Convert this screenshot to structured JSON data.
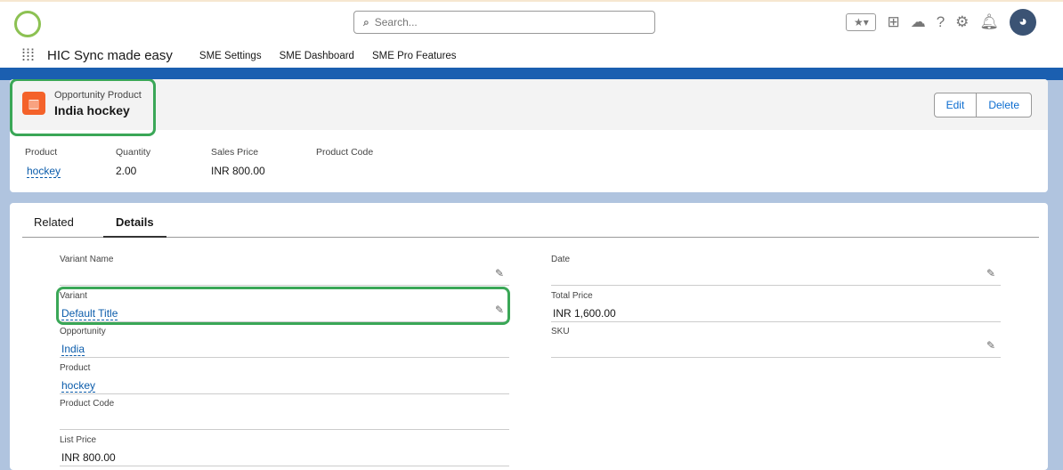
{
  "header": {
    "search_placeholder": "Search...",
    "app_name": "HIC Sync made easy",
    "nav": [
      "SME Settings",
      "SME Dashboard",
      "SME Pro Features"
    ]
  },
  "record": {
    "object": "Opportunity Product",
    "title": "India hockey",
    "edit": "Edit",
    "delete": "Delete",
    "highlights": [
      {
        "label": "Product",
        "value": "hockey"
      },
      {
        "label": "Quantity",
        "value": "2.00"
      },
      {
        "label": "Sales Price",
        "value": "INR 800.00"
      },
      {
        "label": "Product Code",
        "value": ""
      }
    ]
  },
  "tabs": [
    "Related",
    "Details"
  ],
  "left": [
    {
      "label": "Variant Name",
      "value": ""
    },
    {
      "label": "Variant",
      "value": "Default Title"
    },
    {
      "label": "Opportunity",
      "value": "India"
    },
    {
      "label": "Product",
      "value": "hockey"
    },
    {
      "label": "Product Code",
      "value": ""
    },
    {
      "label": "List Price",
      "value": "INR 800.00"
    }
  ],
  "right": [
    {
      "label": "Date",
      "value": ""
    },
    {
      "label": "Total Price",
      "value": "INR 1,600.00"
    },
    {
      "label": "SKU",
      "value": ""
    }
  ]
}
